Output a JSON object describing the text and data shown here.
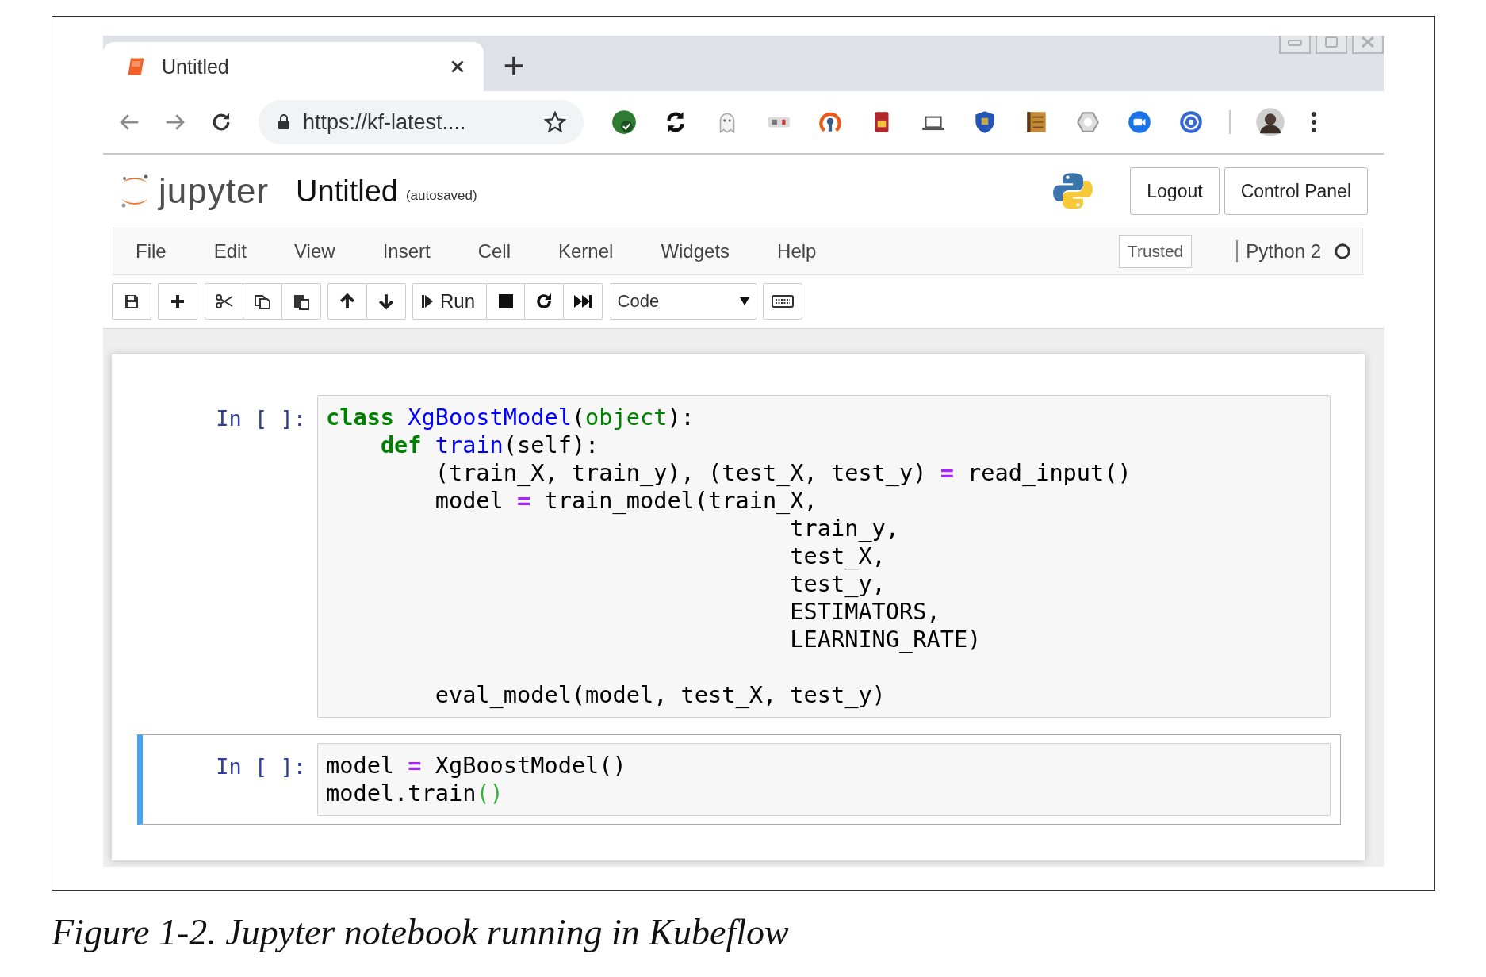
{
  "browser": {
    "tab_title": "Untitled",
    "url": "https://kf-latest...."
  },
  "notebook": {
    "logo_text": "jupyter",
    "title": "Untitled",
    "save_status": "(autosaved)",
    "header_buttons": [
      "Logout",
      "Control Panel"
    ],
    "menu": [
      "File",
      "Edit",
      "View",
      "Insert",
      "Cell",
      "Kernel",
      "Widgets",
      "Help"
    ],
    "trusted": "Trusted",
    "kernel": "Python 2",
    "kernel_busy": false,
    "toolbar": {
      "run": "Run",
      "cell_type": "Code"
    },
    "cells": [
      {
        "prompt": "In [ ]:",
        "selected": false,
        "tokens": [
          {
            "kind": "keyword",
            "text": "class "
          },
          {
            "kind": "class",
            "text": "XgBoostModel"
          },
          {
            "kind": "plain",
            "text": "("
          },
          {
            "kind": "builtin",
            "text": "object"
          },
          {
            "kind": "plain",
            "text": "):\n    "
          },
          {
            "kind": "keyword",
            "text": "def "
          },
          {
            "kind": "function",
            "text": "train"
          },
          {
            "kind": "plain",
            "text": "(self):\n        (train_X, train_y), (test_X, test_y) "
          },
          {
            "kind": "operator",
            "text": "="
          },
          {
            "kind": "plain",
            "text": " read_input()\n        model "
          },
          {
            "kind": "operator",
            "text": "="
          },
          {
            "kind": "plain",
            "text": " train_model(train_X,\n                                  train_y,\n                                  test_X,\n                                  test_y,\n                                  ESTIMATORS,\n                                  LEARNING_RATE)\n\n        eval_model(model, test_X, test_y)"
          }
        ]
      },
      {
        "prompt": "In [ ]:",
        "selected": true,
        "tokens": [
          {
            "kind": "plain",
            "text": "model "
          },
          {
            "kind": "operator",
            "text": "="
          },
          {
            "kind": "plain",
            "text": " XgBoostModel()\nmodel.train"
          },
          {
            "kind": "bracket",
            "text": "()"
          }
        ]
      }
    ]
  },
  "caption": "Figure 1-2. Jupyter notebook running in Kubeflow"
}
